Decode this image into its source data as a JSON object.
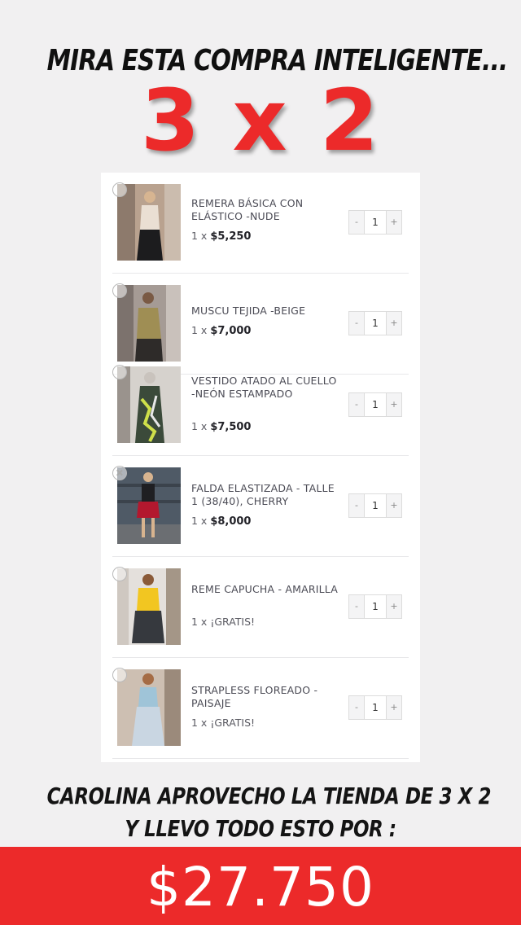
{
  "header": {
    "headline": "MIRA  ESTA COMPRA INTELIGENTE...",
    "promo": "3 x 2"
  },
  "cart": {
    "items": [
      {
        "name": "REMERA BÁSICA CON ELÁSTICO -NUDE",
        "qty_prefix": "1 x",
        "price": "$5,250",
        "quantity": "1",
        "minus": "-",
        "plus": "+"
      },
      {
        "name": "MUSCU TEJIDA -BEIGE",
        "qty_prefix": "1 x",
        "price": "$7,000",
        "quantity": "1",
        "minus": "-",
        "plus": "+"
      },
      {
        "name": "VESTIDO ATADO AL CUELLO -NEÓN ESTAMPADO",
        "qty_prefix": "1 x",
        "price": "$7,500",
        "quantity": "1",
        "minus": "-",
        "plus": "+"
      },
      {
        "name": "FALDA ELASTIZADA - TALLE 1 (38/40), CHERRY",
        "qty_prefix": "1 x",
        "price": "$8,000",
        "quantity": "1",
        "minus": "-",
        "plus": "+"
      },
      {
        "name": "REME CAPUCHA - AMARILLA",
        "qty_prefix": "1 x",
        "price": "¡GRATIS!",
        "quantity": "1",
        "minus": "-",
        "plus": "+"
      },
      {
        "name": "STRAPLESS FLOREADO - PAISAJE",
        "qty_prefix": "1 x",
        "price": "¡GRATIS!",
        "quantity": "1",
        "minus": "-",
        "plus": "+"
      }
    ]
  },
  "footer": {
    "line1": "CAROLINA APROVECHO LA TIENDA DE 3 X 2",
    "line2": "Y LLEVO TODO ESTO POR :",
    "total": "$27.750"
  },
  "colors": {
    "accent_red": "#ec2a2a",
    "background": "#f1f0f1",
    "card": "#ffffff"
  }
}
